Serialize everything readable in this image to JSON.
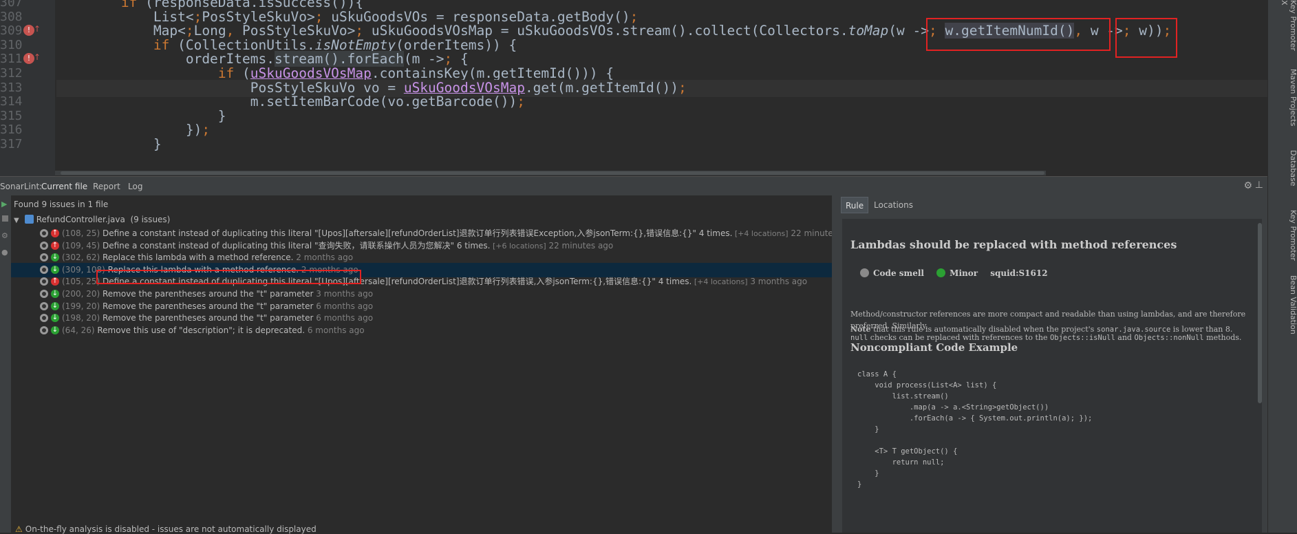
{
  "editor": {
    "line_numbers": [
      "307",
      "308",
      "309",
      "310",
      "311",
      "312",
      "313",
      "314",
      "315",
      "316",
      "317"
    ],
    "gutter_marks": [
      {
        "line": "309"
      },
      {
        "line": "311"
      }
    ],
    "lines": [
      "        if (responseData.isSuccess()){",
      "            List<PosStyleSkuVo> uSkuGoodsVOs = responseData.getBody();",
      "            Map<Long, PosStyleSkuVo> uSkuGoodsVOsMap = uSkuGoodsVOs.stream().collect(Collectors.toMap(w -> w.getItemNumId(), w -> w));",
      "            if (CollectionUtils.isNotEmpty(orderItems)) {",
      "                orderItems.stream().forEach(m -> {",
      "                    if (uSkuGoodsVOsMap.containsKey(m.getItemId())) {",
      "                        PosStyleSkuVo vo = uSkuGoodsVOsMap.get(m.getItemId());",
      "                        m.setItemBarCode(vo.getBarcode());",
      "                    }",
      "                });",
      "            }"
    ]
  },
  "right_strip": {
    "tabs": [
      "Key Promoter X",
      "Maven Projects",
      "Database",
      "Key Promoter",
      "Bean Validation"
    ]
  },
  "sonar": {
    "title": "SonarLint:",
    "tabs": [
      "Current file",
      "Report",
      "Log"
    ],
    "summary": "Found 9 issues in 1 file",
    "file_name": "RefundController.java",
    "file_count": "(9 issues)",
    "issues": [
      {
        "loc": "(108, 25)",
        "severity": "major",
        "msg": "Define a constant instead of duplicating this literal \"[Upos][aftersale][refundOrderList]退款订单行列表错误Exception,入参jsonTerm:{},错误信息:{}\" 4 times.",
        "more": "[+4 locations]",
        "ago": "22 minutes ago"
      },
      {
        "loc": "(109, 45)",
        "severity": "major",
        "msg": "Define a constant instead of duplicating this literal \"查询失败，请联系操作人员为您解决\" 6 times.",
        "more": "[+6 locations]",
        "ago": "22 minutes ago"
      },
      {
        "loc": "(302, 62)",
        "severity": "minor",
        "msg": "Replace this lambda with a method reference.",
        "more": "",
        "ago": "2 months ago"
      },
      {
        "loc": "(309, 108)",
        "severity": "minor",
        "msg": "Replace this lambda with a method reference.",
        "more": "",
        "ago": "2 months ago"
      },
      {
        "loc": "(105, 25)",
        "severity": "major",
        "msg": "Define a constant instead of duplicating this literal \"[Upos][aftersale][refundOrderList]退款订单行列表错误,入参jsonTerm:{},错误信息:{}\" 4 times.",
        "more": "[+4 locations]",
        "ago": "3 months ago"
      },
      {
        "loc": "(200, 20)",
        "severity": "minor",
        "msg": "Remove the parentheses around the \"t\" parameter",
        "more": "",
        "ago": "3 months ago"
      },
      {
        "loc": "(199, 20)",
        "severity": "minor",
        "msg": "Remove the parentheses around the \"t\" parameter",
        "more": "",
        "ago": "6 months ago"
      },
      {
        "loc": "(198, 20)",
        "severity": "minor",
        "msg": "Remove the parentheses around the \"t\" parameter",
        "more": "",
        "ago": "6 months ago"
      },
      {
        "loc": "(64, 26)",
        "severity": "minor",
        "msg": "Remove this use of \"description\"; it is deprecated.",
        "more": "",
        "ago": "6 months ago"
      }
    ],
    "warning": "On-the-fly analysis is disabled - issues are not automatically displayed"
  },
  "rule": {
    "tabs": [
      "Rule",
      "Locations"
    ],
    "title": "Lambdas should be replaced with method references",
    "type": "Code smell",
    "severity": "Minor",
    "key": "squid:S1612",
    "p1_a": "Method/constructor references are more compact and readable than using lambdas, and are therefore preferred. Similarly,",
    "p1_b_code": "null",
    "p1_b": " checks can be replaced with references to the ",
    "p1_b_code2": "Objects::isNull",
    "p1_b_and": " and ",
    "p1_b_code3": "Objects::nonNull",
    "p1_b_end": " methods.",
    "note_bold": "Note",
    "note_a": " that this rule is automatically disabled when the project's ",
    "note_code": "sonar.java.source",
    "note_b": " is lower than 8.",
    "section": "Noncompliant Code Example",
    "code": [
      "class A {",
      "    void process(List<A> list) {",
      "        list.stream()",
      "            .map(a -> a.<String>getObject())",
      "            .forEach(a -> { System.out.println(a); });",
      "    }",
      "",
      "    <T> T getObject() {",
      "        return null;",
      "    }",
      "}"
    ]
  },
  "colors": {
    "major": "#d93131",
    "minor": "#2ba033",
    "highlight_box": "#e22222",
    "selection": "#0d293e"
  }
}
